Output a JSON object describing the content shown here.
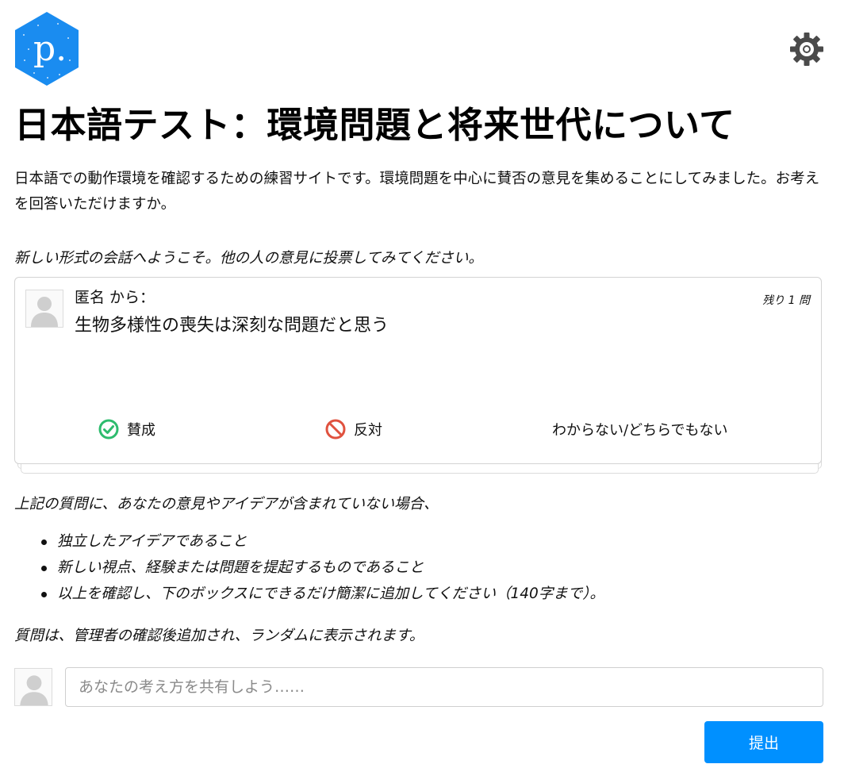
{
  "header": {
    "logo_letter": "p.",
    "settings_icon": "gear-icon"
  },
  "title": "日本語テスト：環境問題と将来世代について",
  "description": "日本語での動作環境を確認するための練習サイトです。環境問題を中心に賛否の意見を集めることにしてみました。お考えを回答いただけますか。",
  "welcome": "新しい形式の会話へようこそ。他の人の意見に投票してみてください。",
  "card": {
    "author": "匿名 から：",
    "remaining": "残り 1 問",
    "statement": "生物多様性の喪失は深刻な問題だと思う",
    "votes": {
      "agree": "賛成",
      "disagree": "反対",
      "pass": "わからない/どちらでもない"
    }
  },
  "guide": {
    "intro": "上記の質問に、あなたの意見やアイデアが含まれていない場合、",
    "bullets": [
      "独立したアイデアであること",
      "新しい視点、経験または問題を提起するものであること",
      "以上を確認し、下のボックスにできるだけ簡潔に追加してください（140字まで）。"
    ],
    "note": "質問は、管理者の確認後追加され、ランダムに表示されます。"
  },
  "composer": {
    "placeholder": "あなたの考え方を共有しよう……",
    "value": "",
    "submit_label": "提出"
  },
  "colors": {
    "logo": "#1a8cf0",
    "agree": "#2ebc6e",
    "disagree": "#e0523f",
    "submit": "#0090ff",
    "gear": "#4a4a4a"
  }
}
